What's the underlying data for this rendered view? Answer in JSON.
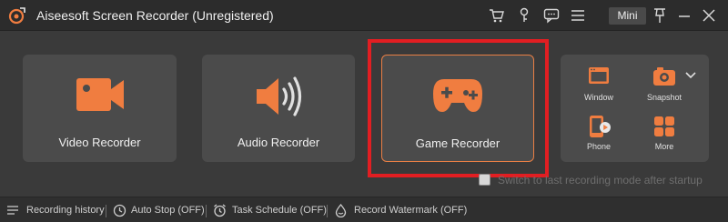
{
  "app": {
    "title": "Aiseesoft Screen Recorder (Unregistered)",
    "mini_label": "Mini"
  },
  "titlebar_icons": [
    "cart-icon",
    "key-icon",
    "feedback-icon",
    "menu-icon",
    "pin-icon",
    "minimize-icon",
    "close-icon"
  ],
  "cards": {
    "video": {
      "label": "Video Recorder",
      "icon": "camcorder-icon"
    },
    "audio": {
      "label": "Audio Recorder",
      "icon": "speaker-icon"
    },
    "game": {
      "label": "Game Recorder",
      "icon": "gamepad-icon"
    }
  },
  "tools": {
    "window": "Window",
    "snapshot": "Snapshot",
    "phone": "Phone",
    "more": "More"
  },
  "switch_text": "Switch to last recording mode after startup",
  "bottom": {
    "history": "Recording history",
    "auto_stop": "Auto Stop (OFF)",
    "task_schedule": "Task Schedule (OFF)",
    "watermark": "Record Watermark (OFF)"
  },
  "colors": {
    "accent": "#f07d40",
    "highlight": "#e21e22",
    "background": "#3a3a3a",
    "card": "#4b4b4b"
  }
}
